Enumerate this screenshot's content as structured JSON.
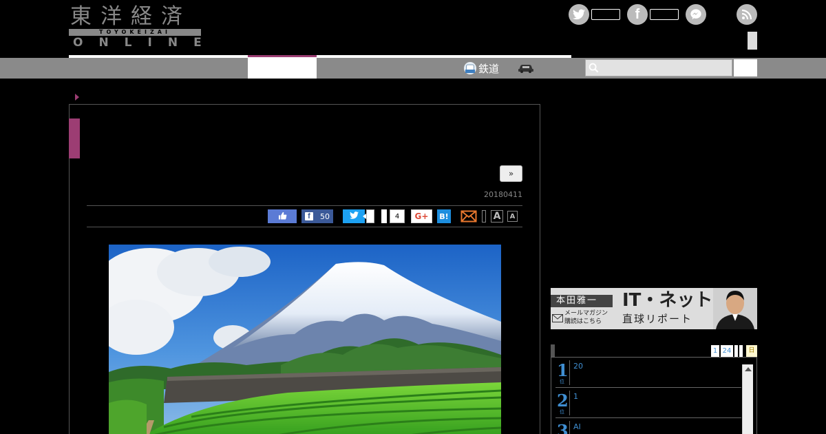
{
  "logo": {
    "kanji": "東洋経済",
    "band": "TOYOKEIZAI",
    "online": "ONLINE"
  },
  "nav": {
    "railway_label": "鉄道"
  },
  "article": {
    "next_label": "»",
    "date": "20180411",
    "share_count": "50",
    "tweet_count": "4"
  },
  "share": {
    "gplus_label": "G+",
    "hatena_label": "B!",
    "font_large": "A",
    "font_small": "A"
  },
  "sidebar": {
    "banner": {
      "author": "本田雅一",
      "title": "IT・ネット",
      "subtitle": "直球リポート",
      "mail_line1": "メールマガジン",
      "mail_line2": "購読はこちら"
    },
    "ranking_tabs": [
      "1",
      "24"
    ],
    "ranking_tab_last": "日",
    "ranking": [
      {
        "rank": "1",
        "text": "20"
      },
      {
        "rank": "2",
        "text": "1"
      },
      {
        "rank": "3",
        "text": "AI"
      }
    ],
    "rank_suffix": "位"
  },
  "colors": {
    "accent": "#9c3d73",
    "nav_gray": "#8a8a8a",
    "link_blue": "#3f8ed1"
  }
}
